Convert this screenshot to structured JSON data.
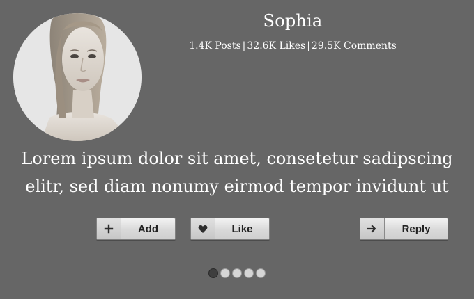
{
  "profile": {
    "name": "Sophia",
    "avatar_icon": "person-portrait-photo",
    "stats": {
      "posts": "1.4K Posts",
      "likes": "32.6K Likes",
      "comments": "29.5K Comments",
      "separator": "|"
    }
  },
  "quote": {
    "line1": "Lorem ipsum dolor sit amet, consetetur sadipscing",
    "line2": "elitr, sed diam nonumy eirmod tempor invidunt ut"
  },
  "actions": {
    "add": {
      "label": "Add",
      "icon": "plus-icon",
      "glyph": "+"
    },
    "like": {
      "label": "Like",
      "icon": "heart-icon",
      "glyph": "♥"
    },
    "reply": {
      "label": "Reply",
      "icon": "arrow-right-icon",
      "glyph": "➜"
    }
  },
  "pagination": {
    "total": 5,
    "active_index": 0
  },
  "colors": {
    "background": "#666666",
    "text": "#ffffff",
    "button_face": "#d9d9d9",
    "dot_active": "#3e3e3e",
    "dot_inactive": "#d6d6d6"
  }
}
